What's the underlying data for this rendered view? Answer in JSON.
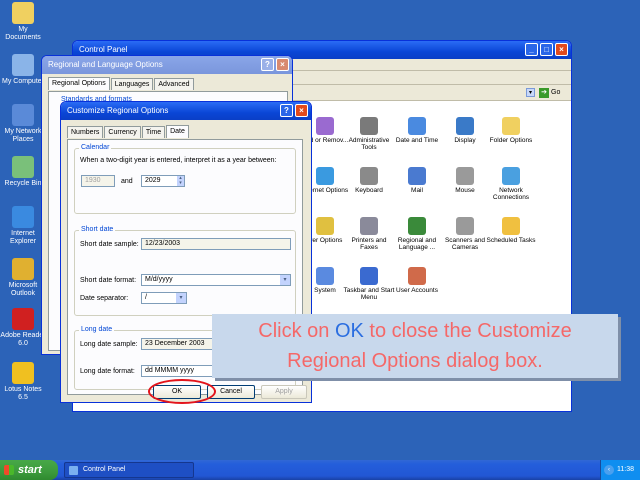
{
  "desktop_icons": [
    {
      "label": "My Documents",
      "icon": "my-documents-icon",
      "color": "#f0d060"
    },
    {
      "label": "My Computer",
      "icon": "my-computer-icon",
      "color": "#8ab4e8"
    },
    {
      "label": "My Network Places",
      "icon": "network-places-icon",
      "color": "#5a8ad8"
    },
    {
      "label": "Recycle Bin",
      "icon": "recycle-bin-icon",
      "color": "#7ac07a"
    },
    {
      "label": "Internet Explorer",
      "icon": "internet-explorer-icon",
      "color": "#3a8ae0"
    },
    {
      "label": "Microsoft Outlook",
      "icon": "outlook-icon",
      "color": "#e0b030"
    },
    {
      "label": "Adobe Reader 6.0",
      "icon": "adobe-reader-icon",
      "color": "#d02020"
    },
    {
      "label": "Lotus Notes 6.5",
      "icon": "lotus-notes-icon",
      "color": "#f0c020"
    }
  ],
  "control_panel": {
    "title": "Control Panel",
    "go_label": "Go",
    "items": [
      {
        "label": "Add or Remov...",
        "icon": "add-remove-programs-icon"
      },
      {
        "label": "Administrative Tools",
        "icon": "administrative-tools-icon"
      },
      {
        "label": "Date and Time",
        "icon": "date-time-icon"
      },
      {
        "label": "Display",
        "icon": "display-icon"
      },
      {
        "label": "Folder Options",
        "icon": "folder-options-icon"
      },
      {
        "label": "Internet Options",
        "icon": "internet-options-icon"
      },
      {
        "label": "Keyboard",
        "icon": "keyboard-icon"
      },
      {
        "label": "Mail",
        "icon": "mail-icon"
      },
      {
        "label": "Mouse",
        "icon": "mouse-icon"
      },
      {
        "label": "Network Connections",
        "icon": "network-connections-icon"
      },
      {
        "label": "wer Options",
        "icon": "power-options-icon"
      },
      {
        "label": "Printers and Faxes",
        "icon": "printers-faxes-icon"
      },
      {
        "label": "Regional and Language ...",
        "icon": "regional-language-icon"
      },
      {
        "label": "Scanners and Cameras",
        "icon": "scanners-cameras-icon"
      },
      {
        "label": "Scheduled Tasks",
        "icon": "scheduled-tasks-icon"
      },
      {
        "label": "System",
        "icon": "system-icon"
      },
      {
        "label": "Taskbar and Start Menu",
        "icon": "taskbar-start-menu-icon"
      },
      {
        "label": "User Accounts",
        "icon": "user-accounts-icon"
      }
    ]
  },
  "regional": {
    "title": "Regional and Language Options",
    "tabs": [
      "Regional Options",
      "Languages",
      "Advanced"
    ],
    "section": "Standards and formats"
  },
  "customize": {
    "title": "Customize Regional Options",
    "tabs": [
      "Numbers",
      "Currency",
      "Time",
      "Date"
    ],
    "active_tab": "Date",
    "calendar": {
      "legend": "Calendar",
      "text": "When a two-digit year is entered, interpret it as a year between:",
      "from": "1930",
      "and": "and",
      "to": "2029"
    },
    "short_date": {
      "legend": "Short date",
      "sample_label": "Short date sample:",
      "sample": "12/23/2003",
      "format_label": "Short date format:",
      "format": "M/d/yyyy",
      "separator_label": "Date separator:",
      "separator": "/"
    },
    "long_date": {
      "legend": "Long date",
      "sample_label": "Long date sample:",
      "sample": "23 December 2003",
      "format_label": "Long date format:",
      "format": "dd MMMM yyyy"
    },
    "buttons": {
      "ok": "OK",
      "cancel": "Cancel",
      "apply": "Apply"
    }
  },
  "callout": {
    "part1": "Click on ",
    "ok": "OK",
    "part2": " to close the Customize",
    "line2": "Regional Options dialog box."
  },
  "taskbar": {
    "start": "start",
    "task": "Control Panel",
    "clock": "11:38"
  }
}
